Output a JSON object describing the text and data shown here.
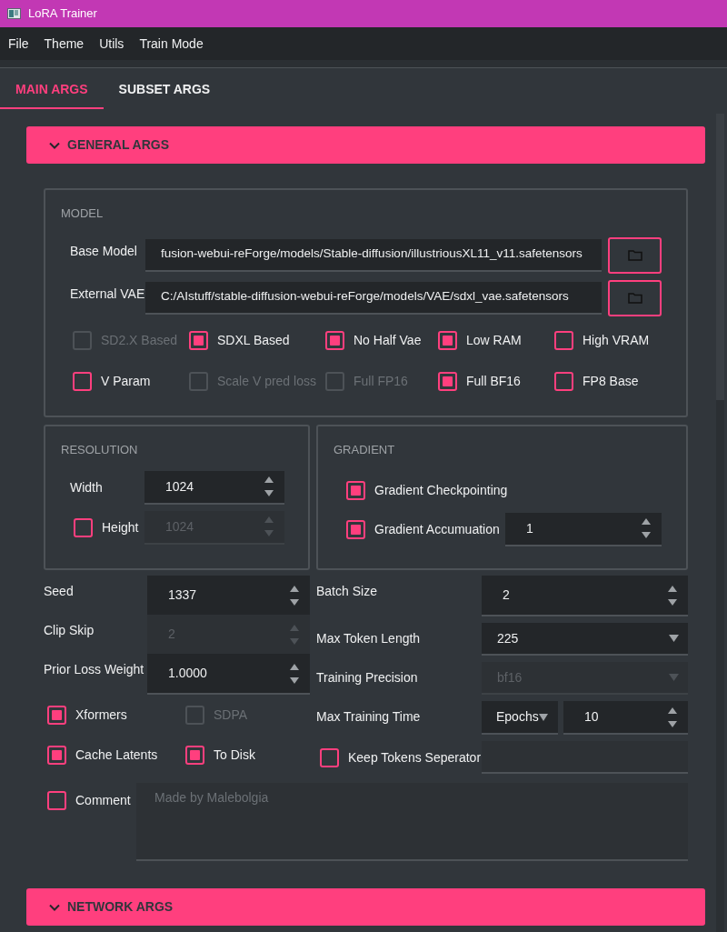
{
  "window": {
    "title": "LoRA Trainer"
  },
  "menu": [
    "File",
    "Theme",
    "Utils",
    "Train Mode"
  ],
  "tabs": [
    {
      "label": "MAIN ARGS",
      "selected": true
    },
    {
      "label": "SUBSET ARGS",
      "selected": false
    }
  ],
  "general_args": {
    "title": "GENERAL ARGS"
  },
  "model": {
    "title": "MODEL",
    "files": [
      {
        "label": "Base Model",
        "value": "fusion-webui-reForge/models/Stable-diffusion/illustriousXL11_v11.safetensors"
      },
      {
        "label": "External VAE",
        "value": "C:/AIstuff/stable-diffusion-webui-reForge/models/VAE/sdxl_vae.safetensors"
      }
    ],
    "options": [
      {
        "label": "SD2.X Based",
        "checked": false,
        "disabled": true
      },
      {
        "label": "SDXL Based",
        "checked": true,
        "disabled": false
      },
      {
        "label": "No Half Vae",
        "checked": true,
        "disabled": false
      },
      {
        "label": "Low RAM",
        "checked": true,
        "disabled": false
      },
      {
        "label": "High VRAM",
        "checked": false,
        "disabled": false
      },
      {
        "label": "V Param",
        "checked": false,
        "disabled": false
      },
      {
        "label": "Scale V pred loss",
        "checked": false,
        "disabled": true
      },
      {
        "label": "Full FP16",
        "checked": false,
        "disabled": true
      },
      {
        "label": "Full BF16",
        "checked": true,
        "disabled": false
      },
      {
        "label": "FP8 Base",
        "checked": false,
        "disabled": false
      }
    ]
  },
  "resolution": {
    "title": "RESOLUTION",
    "width": {
      "label": "Width",
      "value": "1024"
    },
    "height": {
      "label": "Height",
      "value": "1024",
      "checked": false,
      "disabled": true
    }
  },
  "gradient": {
    "title": "GRADIENT",
    "checkpointing": {
      "label": "Gradient Checkpointing",
      "checked": true
    },
    "accumulation": {
      "label": "Gradient Accumuation",
      "checked": true,
      "value": "1"
    }
  },
  "left_fields": [
    {
      "label": "Seed",
      "value": "1337",
      "disabled": false
    },
    {
      "label": "Clip Skip",
      "value": "2",
      "disabled": true
    },
    {
      "label": "Prior Loss Weight",
      "value": "1.0000",
      "disabled": false
    }
  ],
  "left_checks": [
    {
      "label": "Xformers",
      "checked": true,
      "disabled": false
    },
    {
      "label": "SDPA",
      "checked": false,
      "disabled": true
    },
    {
      "label": "Cache Latents",
      "checked": true,
      "disabled": false
    },
    {
      "label": "To Disk",
      "checked": true,
      "disabled": false
    }
  ],
  "comment": {
    "label": "Comment",
    "checked": false,
    "placeholder": "Made by Malebolgia"
  },
  "right_fields": [
    {
      "kind": "spin",
      "label": "Batch Size",
      "value": "2",
      "disabled": false
    },
    {
      "kind": "select",
      "label": "Max Token Length",
      "value": "225",
      "disabled": false
    },
    {
      "kind": "select",
      "label": "Training Precision",
      "value": "bf16",
      "disabled": true
    },
    {
      "kind": "time",
      "label": "Max Training Time",
      "unit": "Epochs",
      "value": "10",
      "disabled": false
    }
  ],
  "keep_tokens": {
    "label": "Keep Tokens Seperator",
    "checked": false
  },
  "network_args": {
    "title": "NETWORK ARGS"
  }
}
